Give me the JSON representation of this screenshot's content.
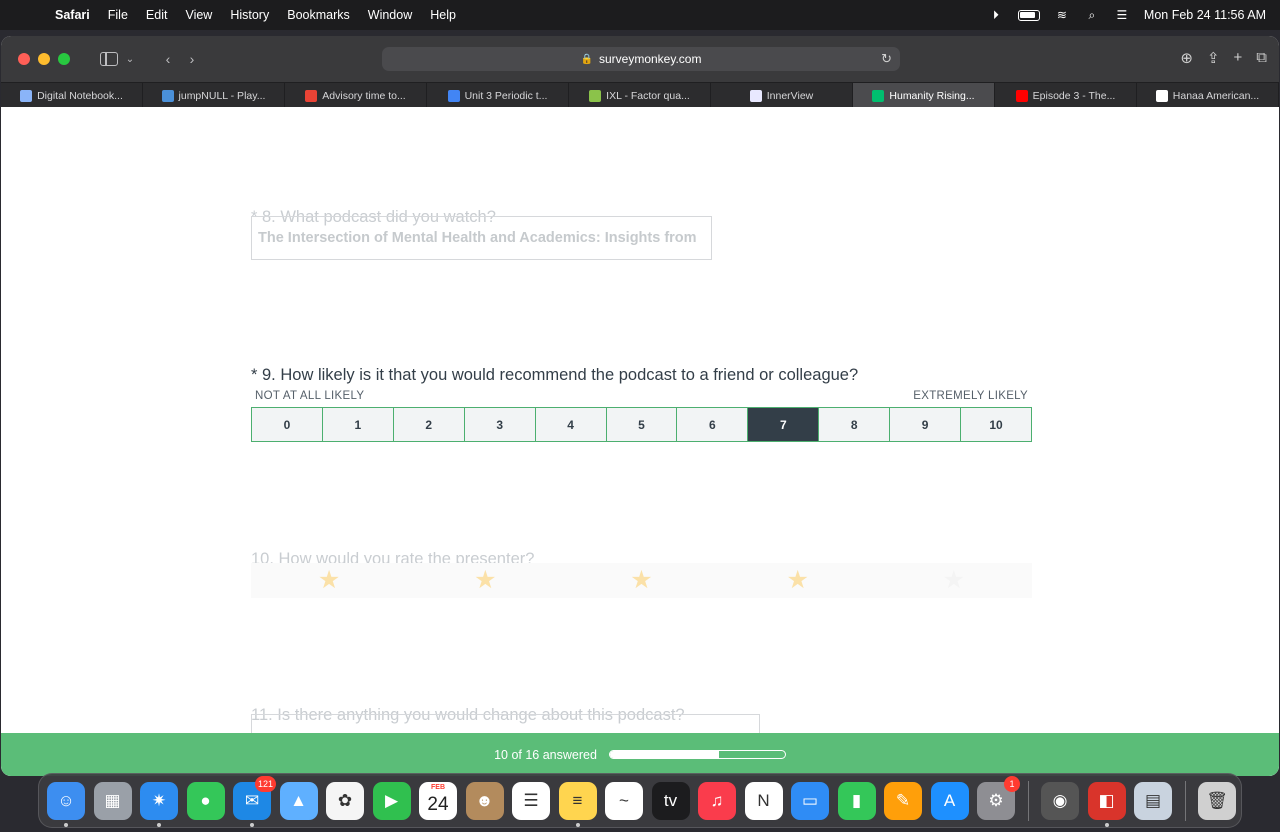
{
  "menubar": {
    "app": "Safari",
    "items": [
      "File",
      "Edit",
      "View",
      "History",
      "Bookmarks",
      "Window",
      "Help"
    ],
    "clock": "Mon Feb 24  11:56 AM"
  },
  "browser": {
    "url": "surveymonkey.com",
    "tabs": [
      {
        "label": "Digital Notebook...",
        "color": "#8ab4f8"
      },
      {
        "label": "jumpNULL - Play...",
        "color": "#4a90d9"
      },
      {
        "label": "Advisory time to...",
        "color": "#ea4335"
      },
      {
        "label": "Unit 3 Periodic t...",
        "color": "#4285f4"
      },
      {
        "label": "IXL - Factor qua...",
        "color": "#8bc34a"
      },
      {
        "label": "InnerView",
        "color": "#e8e8ff"
      },
      {
        "label": "Humanity Rising...",
        "color": "#00bf6f"
      },
      {
        "label": "Episode 3 - The...",
        "color": "#ff0000"
      },
      {
        "label": "Hanaa American...",
        "color": "#ffffff"
      }
    ],
    "active_tab": 6
  },
  "survey": {
    "q8": {
      "text": "* 8. What podcast did you watch?",
      "answer": "The Intersection of Mental Health and Academics: Insights from"
    },
    "q9": {
      "text": "* 9. How likely is it that you would recommend the podcast to a friend or colleague?",
      "low_label": "NOT AT ALL LIKELY",
      "high_label": "EXTREMELY LIKELY",
      "options": [
        "0",
        "1",
        "2",
        "3",
        "4",
        "5",
        "6",
        "7",
        "8",
        "9",
        "10"
      ],
      "selected": "7"
    },
    "q10": {
      "text": "10. How would you rate the presenter?",
      "stars_total": 5,
      "stars_filled": 4
    },
    "q11": {
      "text": "11. Is there anything you would change about this podcast?"
    }
  },
  "progress": {
    "text": "10 of 16 answered",
    "fraction": 0.625
  },
  "dock": {
    "mail_badge": "121",
    "calendar_month": "FEB",
    "calendar_day": "24",
    "settings_badge": "1",
    "apps": [
      {
        "name": "finder",
        "color": "#3d8ef0",
        "glyph": "☺"
      },
      {
        "name": "launchpad",
        "color": "#9aa0a8",
        "glyph": "▦"
      },
      {
        "name": "safari",
        "color": "#2d8cf0",
        "glyph": "✷"
      },
      {
        "name": "messages",
        "color": "#34c759",
        "glyph": "●"
      },
      {
        "name": "mail",
        "color": "#1e88e5",
        "glyph": "✉"
      },
      {
        "name": "maps",
        "color": "#5fb0ff",
        "glyph": "▲"
      },
      {
        "name": "photos",
        "color": "#f5f5f5",
        "glyph": "✿"
      },
      {
        "name": "facetime",
        "color": "#30c04f",
        "glyph": "▶"
      },
      {
        "name": "calendar",
        "color": "#ffffff",
        "glyph": ""
      },
      {
        "name": "contacts",
        "color": "#b38b5d",
        "glyph": "☻"
      },
      {
        "name": "reminders",
        "color": "#ffffff",
        "glyph": "☰"
      },
      {
        "name": "notes",
        "color": "#ffd54f",
        "glyph": "≡"
      },
      {
        "name": "freeform",
        "color": "#ffffff",
        "glyph": "~"
      },
      {
        "name": "apple-tv",
        "color": "#1c1c1e",
        "glyph": "tv"
      },
      {
        "name": "music",
        "color": "#fa3c4c",
        "glyph": "♫"
      },
      {
        "name": "news",
        "color": "#ffffff",
        "glyph": "N"
      },
      {
        "name": "keynote",
        "color": "#2f8cf5",
        "glyph": "▭"
      },
      {
        "name": "numbers",
        "color": "#34c759",
        "glyph": "▮"
      },
      {
        "name": "pages",
        "color": "#ff9f0a",
        "glyph": "✎"
      },
      {
        "name": "app-store",
        "color": "#1e90ff",
        "glyph": "A"
      },
      {
        "name": "system-settings",
        "color": "#8e8e93",
        "glyph": "⚙"
      }
    ],
    "recent": [
      {
        "name": "photo-booth",
        "color": "#555",
        "glyph": "◉"
      },
      {
        "name": "photo-booth-2",
        "color": "#d9342b",
        "glyph": "◧"
      },
      {
        "name": "preview",
        "color": "#c9d3df",
        "glyph": "▤"
      }
    ],
    "trash": {
      "name": "trash",
      "color": "#d0d0d0",
      "glyph": "🗑"
    }
  }
}
